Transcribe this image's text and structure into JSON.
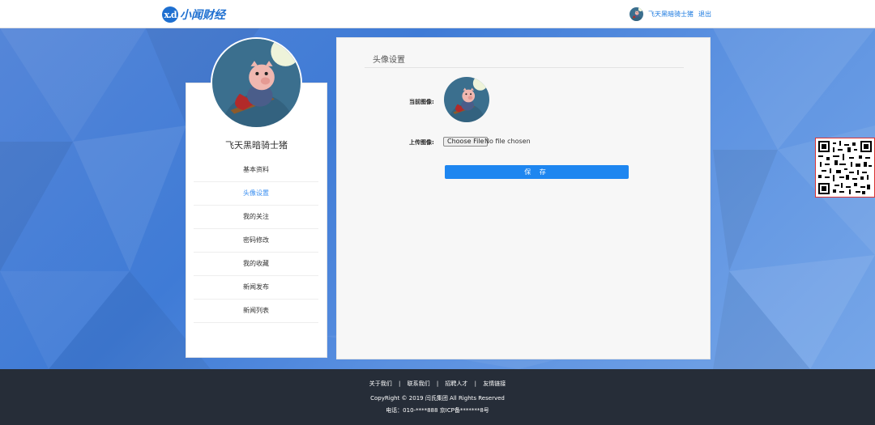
{
  "header": {
    "logo_mark": "x.d",
    "logo_text": "小闻财经",
    "username": "飞天黑暗骑士猪",
    "logout_label": "退出"
  },
  "sidebar": {
    "name": "飞天黑暗骑士猪",
    "items": [
      {
        "label": "基本资料"
      },
      {
        "label": "头像设置"
      },
      {
        "label": "我的关注"
      },
      {
        "label": "密码修改"
      },
      {
        "label": "我的收藏"
      },
      {
        "label": "新闻发布"
      },
      {
        "label": "新闻列表"
      }
    ],
    "active_index": 1
  },
  "main": {
    "title": "头像设置",
    "current_label": "当前图像:",
    "upload_label": "上传图像:",
    "file_button": "Choose File",
    "file_status": "No file chosen",
    "save_label": "保 存"
  },
  "footer": {
    "links": [
      "关于我们",
      "联系我们",
      "招聘人才",
      "友情链接"
    ],
    "separator": "|",
    "copyright": "CopyRight © 2019 闫氏集团 All Rights Reserved",
    "tel": "电话：010-****888 京ICP备*******8号"
  },
  "colors": {
    "accent": "#1e86f0",
    "footer_bg": "#262d38",
    "active_menu": "#3b8ff0"
  }
}
